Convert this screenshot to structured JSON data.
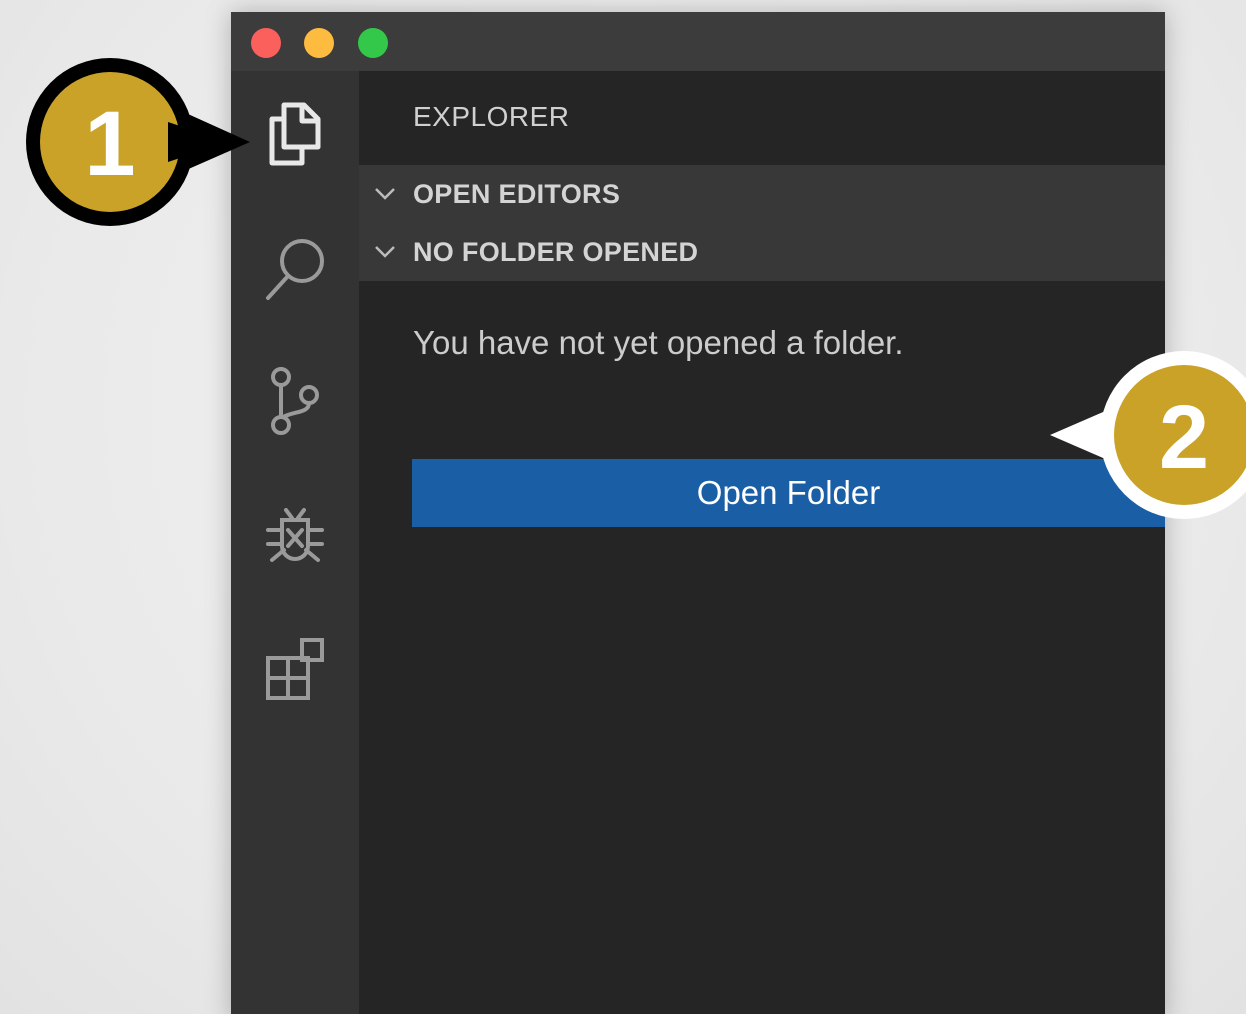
{
  "sidebar": {
    "title": "EXPLORER",
    "sections": [
      {
        "label": "OPEN EDITORS"
      },
      {
        "label": "NO FOLDER OPENED"
      }
    ],
    "message": "You have not yet opened a folder.",
    "open_folder_label": "Open Folder"
  },
  "activity_bar": {
    "items": [
      "files-icon",
      "search-icon",
      "source-control-icon",
      "debug-icon",
      "extensions-icon"
    ]
  },
  "callouts": {
    "first": "1",
    "second": "2"
  },
  "colors": {
    "callout_fill": "#c9a227",
    "button_blue": "#1a5fa5",
    "titlebar": "#3c3c3c",
    "activity_bar": "#333333",
    "sidebar": "#252526"
  }
}
